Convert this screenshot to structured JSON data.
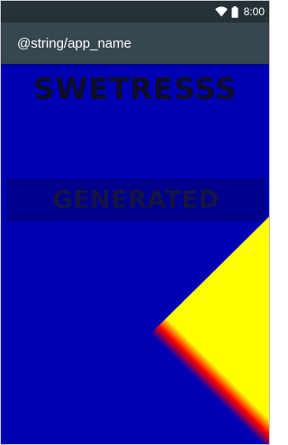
{
  "status_bar": {
    "time": "8:00",
    "icons": [
      "wifi-icon",
      "battery-icon"
    ],
    "background": "#263238",
    "foreground": "#ffffff"
  },
  "app_bar": {
    "title": "@string/app_name",
    "background": "#37474f"
  },
  "content": {
    "name": "SWETRESSS",
    "label": "GENERATED",
    "colors": {
      "background": "#0000b4",
      "stripe": "#ff0000",
      "corner": "#ffff00"
    }
  }
}
